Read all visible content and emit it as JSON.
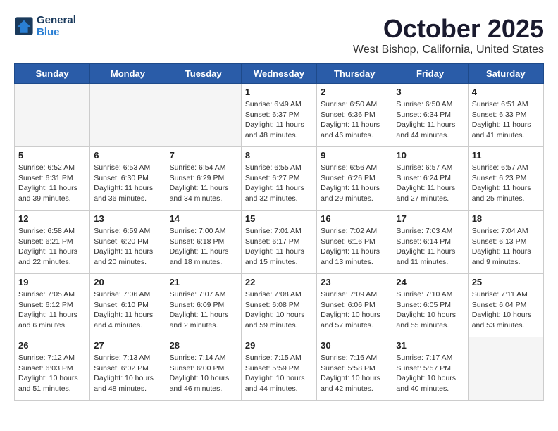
{
  "header": {
    "logo_line1": "General",
    "logo_line2": "Blue",
    "month_title": "October 2025",
    "location": "West Bishop, California, United States"
  },
  "days_of_week": [
    "Sunday",
    "Monday",
    "Tuesday",
    "Wednesday",
    "Thursday",
    "Friday",
    "Saturday"
  ],
  "weeks": [
    [
      {
        "num": "",
        "detail": ""
      },
      {
        "num": "",
        "detail": ""
      },
      {
        "num": "",
        "detail": ""
      },
      {
        "num": "1",
        "detail": "Sunrise: 6:49 AM\nSunset: 6:37 PM\nDaylight: 11 hours and 48 minutes."
      },
      {
        "num": "2",
        "detail": "Sunrise: 6:50 AM\nSunset: 6:36 PM\nDaylight: 11 hours and 46 minutes."
      },
      {
        "num": "3",
        "detail": "Sunrise: 6:50 AM\nSunset: 6:34 PM\nDaylight: 11 hours and 44 minutes."
      },
      {
        "num": "4",
        "detail": "Sunrise: 6:51 AM\nSunset: 6:33 PM\nDaylight: 11 hours and 41 minutes."
      }
    ],
    [
      {
        "num": "5",
        "detail": "Sunrise: 6:52 AM\nSunset: 6:31 PM\nDaylight: 11 hours and 39 minutes."
      },
      {
        "num": "6",
        "detail": "Sunrise: 6:53 AM\nSunset: 6:30 PM\nDaylight: 11 hours and 36 minutes."
      },
      {
        "num": "7",
        "detail": "Sunrise: 6:54 AM\nSunset: 6:29 PM\nDaylight: 11 hours and 34 minutes."
      },
      {
        "num": "8",
        "detail": "Sunrise: 6:55 AM\nSunset: 6:27 PM\nDaylight: 11 hours and 32 minutes."
      },
      {
        "num": "9",
        "detail": "Sunrise: 6:56 AM\nSunset: 6:26 PM\nDaylight: 11 hours and 29 minutes."
      },
      {
        "num": "10",
        "detail": "Sunrise: 6:57 AM\nSunset: 6:24 PM\nDaylight: 11 hours and 27 minutes."
      },
      {
        "num": "11",
        "detail": "Sunrise: 6:57 AM\nSunset: 6:23 PM\nDaylight: 11 hours and 25 minutes."
      }
    ],
    [
      {
        "num": "12",
        "detail": "Sunrise: 6:58 AM\nSunset: 6:21 PM\nDaylight: 11 hours and 22 minutes."
      },
      {
        "num": "13",
        "detail": "Sunrise: 6:59 AM\nSunset: 6:20 PM\nDaylight: 11 hours and 20 minutes."
      },
      {
        "num": "14",
        "detail": "Sunrise: 7:00 AM\nSunset: 6:18 PM\nDaylight: 11 hours and 18 minutes."
      },
      {
        "num": "15",
        "detail": "Sunrise: 7:01 AM\nSunset: 6:17 PM\nDaylight: 11 hours and 15 minutes."
      },
      {
        "num": "16",
        "detail": "Sunrise: 7:02 AM\nSunset: 6:16 PM\nDaylight: 11 hours and 13 minutes."
      },
      {
        "num": "17",
        "detail": "Sunrise: 7:03 AM\nSunset: 6:14 PM\nDaylight: 11 hours and 11 minutes."
      },
      {
        "num": "18",
        "detail": "Sunrise: 7:04 AM\nSunset: 6:13 PM\nDaylight: 11 hours and 9 minutes."
      }
    ],
    [
      {
        "num": "19",
        "detail": "Sunrise: 7:05 AM\nSunset: 6:12 PM\nDaylight: 11 hours and 6 minutes."
      },
      {
        "num": "20",
        "detail": "Sunrise: 7:06 AM\nSunset: 6:10 PM\nDaylight: 11 hours and 4 minutes."
      },
      {
        "num": "21",
        "detail": "Sunrise: 7:07 AM\nSunset: 6:09 PM\nDaylight: 11 hours and 2 minutes."
      },
      {
        "num": "22",
        "detail": "Sunrise: 7:08 AM\nSunset: 6:08 PM\nDaylight: 10 hours and 59 minutes."
      },
      {
        "num": "23",
        "detail": "Sunrise: 7:09 AM\nSunset: 6:06 PM\nDaylight: 10 hours and 57 minutes."
      },
      {
        "num": "24",
        "detail": "Sunrise: 7:10 AM\nSunset: 6:05 PM\nDaylight: 10 hours and 55 minutes."
      },
      {
        "num": "25",
        "detail": "Sunrise: 7:11 AM\nSunset: 6:04 PM\nDaylight: 10 hours and 53 minutes."
      }
    ],
    [
      {
        "num": "26",
        "detail": "Sunrise: 7:12 AM\nSunset: 6:03 PM\nDaylight: 10 hours and 51 minutes."
      },
      {
        "num": "27",
        "detail": "Sunrise: 7:13 AM\nSunset: 6:02 PM\nDaylight: 10 hours and 48 minutes."
      },
      {
        "num": "28",
        "detail": "Sunrise: 7:14 AM\nSunset: 6:00 PM\nDaylight: 10 hours and 46 minutes."
      },
      {
        "num": "29",
        "detail": "Sunrise: 7:15 AM\nSunset: 5:59 PM\nDaylight: 10 hours and 44 minutes."
      },
      {
        "num": "30",
        "detail": "Sunrise: 7:16 AM\nSunset: 5:58 PM\nDaylight: 10 hours and 42 minutes."
      },
      {
        "num": "31",
        "detail": "Sunrise: 7:17 AM\nSunset: 5:57 PM\nDaylight: 10 hours and 40 minutes."
      },
      {
        "num": "",
        "detail": ""
      }
    ]
  ]
}
